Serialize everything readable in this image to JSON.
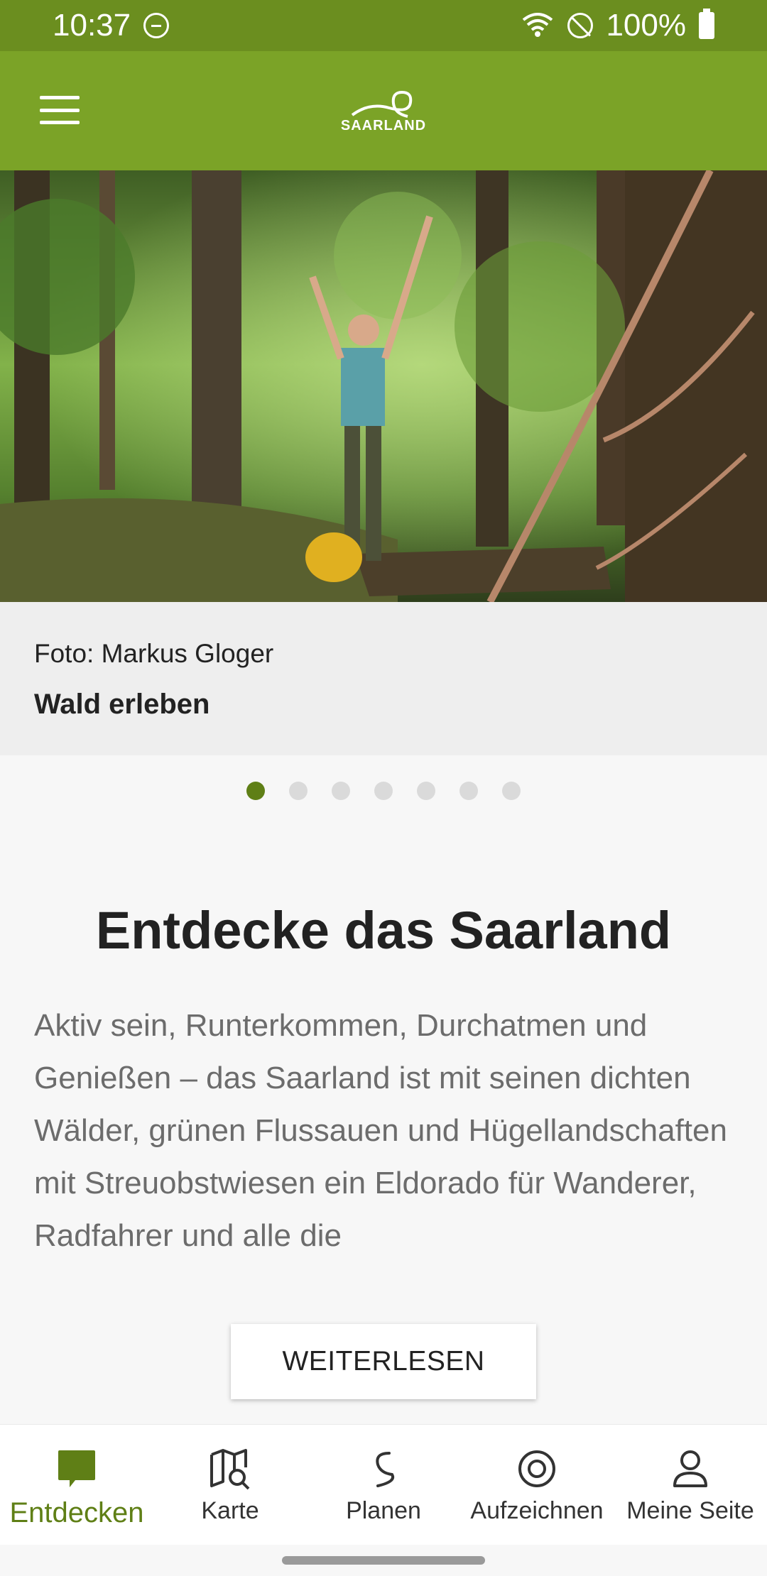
{
  "status_bar": {
    "time": "10:37",
    "battery": "100%",
    "icons": [
      "do-not-disturb-icon",
      "wifi-icon",
      "blocked-icon",
      "battery-icon"
    ]
  },
  "app_bar": {
    "logo_text": "SAARLAND",
    "menu_icon": "hamburger-menu-icon",
    "color": "#7ba327"
  },
  "hero": {
    "credit": "Foto: Markus Gloger",
    "title": "Wald erleben"
  },
  "carousel": {
    "page_count": 7,
    "current_index": 0
  },
  "content": {
    "headline": "Entdecke das Saarland",
    "body": "Aktiv sein, Runterkommen, Durchatmen und Genießen – das Saarland ist mit seinen dichten Wälder, grünen Flussauen und Hügellandschaften mit Streuobstwiesen ein Eldorado für Wanderer, Radfahrer und alle die",
    "read_more_label": "WEITERLESEN"
  },
  "bottom_nav": {
    "items": [
      {
        "label": "Entdecken",
        "icon": "speech-bubble-icon",
        "active": true
      },
      {
        "label": "Karte",
        "icon": "map-search-icon",
        "active": false
      },
      {
        "label": "Planen",
        "icon": "route-icon",
        "active": false
      },
      {
        "label": "Aufzeichnen",
        "icon": "record-target-icon",
        "active": false
      },
      {
        "label": "Meine Seite",
        "icon": "user-icon",
        "active": false
      }
    ]
  },
  "colors": {
    "status_bar": "#6b8e1f",
    "accent": "#5f7f16"
  }
}
